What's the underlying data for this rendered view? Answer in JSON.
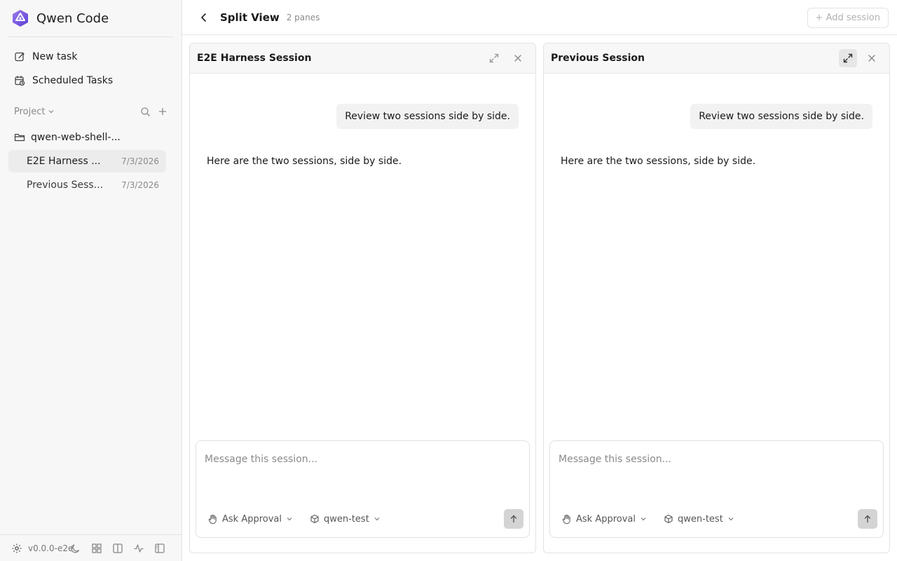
{
  "brand": {
    "name": "Qwen Code"
  },
  "nav": {
    "new_task": "New task",
    "scheduled_tasks": "Scheduled Tasks"
  },
  "project": {
    "label": "Project",
    "folder": "qwen-web-shell-..."
  },
  "sessions": [
    {
      "title": "E2E Harness ...",
      "date": "7/3/2026",
      "active": true
    },
    {
      "title": "Previous Sess...",
      "date": "7/3/2026",
      "active": false
    }
  ],
  "footer": {
    "version": "v0.0.0-e2e"
  },
  "topbar": {
    "title": "Split View",
    "subtitle": "2 panes",
    "add_session": "+ Add session"
  },
  "panes": [
    {
      "title": "E2E Harness Session",
      "user_message": "Review two sessions side by side.",
      "assistant_message": "Here are the two sessions, side by side.",
      "composer": {
        "placeholder": "Message this session...",
        "approval": "Ask Approval",
        "model": "qwen-test"
      }
    },
    {
      "title": "Previous Session",
      "user_message": "Review two sessions side by side.",
      "assistant_message": "Here are the two sessions, side by side.",
      "composer": {
        "placeholder": "Message this session...",
        "approval": "Ask Approval",
        "model": "qwen-test"
      }
    }
  ],
  "colors": {
    "brand_accent": "#7c5ce0",
    "sidebar_bg": "#f7f7f7",
    "active_item_bg": "#ececec"
  }
}
